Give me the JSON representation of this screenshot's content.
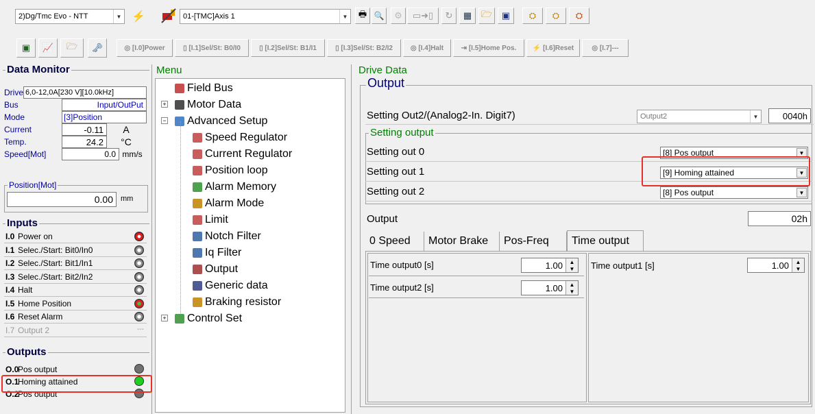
{
  "toolbar": {
    "device_combo": "2)Dg/Tmc Evo - NTT",
    "axis_combo": "01-[TMC]Axis 1",
    "io_buttons": [
      "[I.0]Power",
      "[I.1]Sel/St: B0/I0",
      "[I.2]Sel/St: B1/I1",
      "[I.3]Sel/St: B2/I2",
      "[I.4]Halt",
      "[I.5]Home Pos.",
      "[I.6]Reset",
      "[I.7]---"
    ]
  },
  "data_monitor": {
    "title": "Data Monitor",
    "rows": [
      {
        "label": "Drive",
        "value": "6,0-12,0A[230 V][10.0kHz]",
        "unit": ""
      },
      {
        "label": "Bus",
        "value": "Input/OutPut",
        "unit": ""
      },
      {
        "label": "Mode",
        "value": "[3]Position",
        "unit": ""
      },
      {
        "label": "Current",
        "value": "-0.11",
        "unit": "A"
      },
      {
        "label": "Temp.",
        "value": "24.2",
        "unit": "°C"
      },
      {
        "label": "Speed[Mot]",
        "value": "0.0",
        "unit": "mm/s"
      }
    ],
    "position_title": "Position[Mot]",
    "position_value": "0.00",
    "position_unit": "mm"
  },
  "inputs": {
    "title": "Inputs",
    "items": [
      {
        "id": "I.0",
        "label": "Power on",
        "state": "red"
      },
      {
        "id": "I.1",
        "label": "Selec./Start: Bit0/In0",
        "state": "off"
      },
      {
        "id": "I.2",
        "label": "Selec./Start: Bit1/In1",
        "state": "off"
      },
      {
        "id": "I.3",
        "label": "Selec./Start: Bit2/In2",
        "state": "off"
      },
      {
        "id": "I.4",
        "label": "Halt",
        "state": "off"
      },
      {
        "id": "I.5",
        "label": "Home Position",
        "state": "red"
      },
      {
        "id": "I.6",
        "label": "Reset Alarm",
        "state": "off"
      },
      {
        "id": "I.7",
        "label": "Output 2",
        "state": "---"
      }
    ]
  },
  "outputs": {
    "title": "Outputs",
    "items": [
      {
        "id": "O.0",
        "label": "Pos output",
        "state": "gray"
      },
      {
        "id": "O.1",
        "label": "Homing attained",
        "state": "green"
      },
      {
        "id": "O.2",
        "label": "Pos output",
        "state": "gray"
      }
    ]
  },
  "menu": {
    "title": "Menu",
    "items": [
      {
        "label": "Field Bus",
        "icon": "fieldbus-icon"
      },
      {
        "label": "Motor Data",
        "icon": "motor-icon"
      },
      {
        "label": "Advanced Setup",
        "icon": "setup-icon"
      },
      {
        "label": "Speed Regulator",
        "icon": "speed-regulator-icon"
      },
      {
        "label": "Current Regulator",
        "icon": "current-regulator-icon"
      },
      {
        "label": "Position loop",
        "icon": "position-loop-icon"
      },
      {
        "label": "Alarm Memory",
        "icon": "alarm-memory-icon"
      },
      {
        "label": "Alarm Mode",
        "icon": "alarm-mode-icon"
      },
      {
        "label": "Limit",
        "icon": "limit-icon"
      },
      {
        "label": "Notch Filter",
        "icon": "notch-filter-icon"
      },
      {
        "label": "Iq Filter",
        "icon": "iq-filter-icon"
      },
      {
        "label": "Output",
        "icon": "output-icon"
      },
      {
        "label": "Generic data",
        "icon": "generic-data-icon"
      },
      {
        "label": "Braking resistor",
        "icon": "braking-resistor-icon"
      },
      {
        "label": "Control Set",
        "icon": "control-set-icon"
      }
    ]
  },
  "drive_data": {
    "title": "Drive Data",
    "output_title": "Output",
    "setting_out2_label": "Setting Out2/(Analog2-In. Digit7)",
    "setting_out2_combo": "Output2",
    "setting_out2_hex": "0040h",
    "setting_output_title": "Setting output",
    "settings": [
      {
        "label": "Setting out 0",
        "value": "[8] Pos output"
      },
      {
        "label": "Setting out 1",
        "value": "[9] Homing attained"
      },
      {
        "label": "Setting out 2",
        "value": "[8] Pos output"
      }
    ],
    "output_label": "Output",
    "output_value": "02h",
    "tabs": [
      "0 Speed",
      "Motor Brake",
      "Pos-Freq",
      "Time output"
    ],
    "time_outputs": [
      {
        "label": "Time output0 [s]",
        "value": "1.00"
      },
      {
        "label": "Time output1 [s]",
        "value": "1.00"
      },
      {
        "label": "Time output2 [s]",
        "value": "1.00"
      }
    ]
  }
}
